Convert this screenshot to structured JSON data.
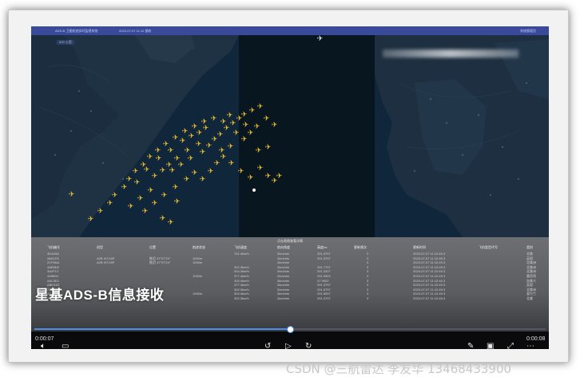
{
  "window": {
    "title": "ADS-B 卫星航迹实时监视系统",
    "subtitle": "2023-07-07 11:12 接收",
    "user": "系统管理员"
  },
  "map": {
    "badge": "500 公里",
    "planes_color": "#f0c030"
  },
  "table": {
    "hint": "点击表格查看详情",
    "headers": [
      "飞机编号",
      "机型",
      "位置",
      "航迹状态",
      "飞机速度",
      "航向角度",
      "高度/m",
      "更新频次",
      "更新时间",
      "飞机类型代号",
      "类别"
    ],
    "rows": [
      [
        "3D4A9A",
        "",
        "",
        "",
        "761.4km/h",
        "2km/min",
        "291.3797",
        "3",
        "2023-07-07 11:12:49.3",
        "",
        "北美"
      ],
      [
        "A6A1F8",
        "A2B 3/7/16P",
        "推迟 47°07'24\"",
        "1000m",
        "",
        "2km/min",
        "291.3797",
        "3",
        "2023-07-07 11:12:49.3",
        "",
        "英国"
      ],
      [
        "2CF8AA",
        "A2B 3/7/16P",
        "推迟 47°07'24\"",
        "1000m",
        "",
        "2km/min",
        "",
        "3",
        "2023-07-07 11:12:49.3",
        "",
        "北美洲"
      ],
      [
        "4AE8D0",
        "",
        "",
        "",
        "302.3km/h",
        "2km/min",
        "291.7797",
        "3",
        "2023-07-07 11:12:49.3",
        "",
        "北美洲"
      ],
      [
        "3A2F1C",
        "",
        "",
        "",
        "304.3km/h",
        "2km/min",
        "291.3327",
        "3",
        "2023-07-07 11:12:49.3",
        "",
        "北美洲"
      ],
      [
        "44B8D2",
        "",
        "",
        "1000m",
        "377.4km/h",
        "2km/min",
        "291.9902",
        "3",
        "2023-07-07 11:12:49.3",
        "",
        "墨西哥"
      ],
      [
        "A8C3E2",
        "",
        "",
        "",
        "304.4km/h",
        "3km/min",
        "47.9902",
        "3",
        "2023-07-07 11:12:49.3",
        "",
        "加拿大"
      ],
      [
        "ABE41D",
        "",
        "",
        "",
        "377.4km/h",
        "2km/min",
        "291.3797",
        "3",
        "2023-07-07 11:12:49.3",
        "",
        "英国"
      ],
      [
        "71D2EF",
        "",
        "",
        "",
        "302.3km/h",
        "2km/min",
        "291.5797",
        "3",
        "2023-07-07 11:12:49.3",
        "",
        "北美洲"
      ],
      [
        "4CAA01",
        "",
        "",
        "1000m",
        "304.4km/h",
        "3km/min",
        "291.6057",
        "3",
        "2023-07-07 11:12:49.3",
        "",
        "爱尔兰"
      ],
      [
        "76B2C4",
        "",
        "",
        "",
        "302.3km/h",
        "2km/min",
        "291.3797",
        "3",
        "2023-07-07 11:12:49.3",
        "",
        "北美"
      ]
    ]
  },
  "caption": "星基ADS-B信息接收",
  "player": {
    "elapsed": "0:00:07",
    "duration": "0:00:08",
    "progress_fraction": 0.5,
    "accent": "#4a8fe6"
  },
  "watermark": "CSDN @三航雷达 李友华 13468433900"
}
